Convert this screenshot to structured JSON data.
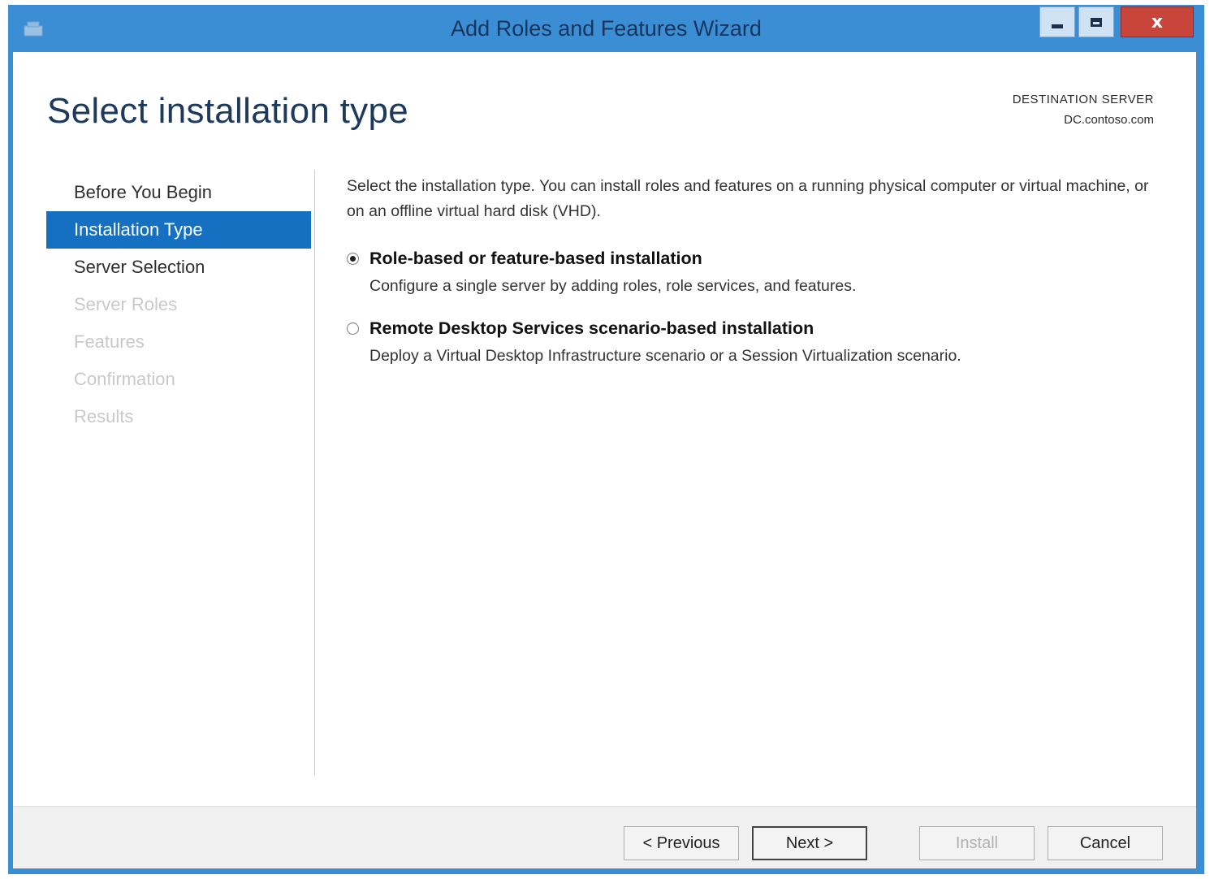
{
  "window": {
    "title": "Add Roles and Features Wizard",
    "controls": [
      "minimize-icon",
      "maximize-icon",
      "close-icon"
    ],
    "close_glyph": "x",
    "title_bar_color": "#3c8ed4",
    "close_color": "#c7453a"
  },
  "header": {
    "page_title": "Select installation type",
    "destination_label": "DESTINATION SERVER",
    "destination_value": "DC.contoso.com"
  },
  "nav": {
    "items": [
      {
        "label": "Before You Begin",
        "state": "enabled"
      },
      {
        "label": "Installation Type",
        "state": "selected"
      },
      {
        "label": "Server Selection",
        "state": "enabled"
      },
      {
        "label": "Server Roles",
        "state": "disabled"
      },
      {
        "label": "Features",
        "state": "disabled"
      },
      {
        "label": "Confirmation",
        "state": "disabled"
      },
      {
        "label": "Results",
        "state": "disabled"
      }
    ],
    "selected_color": "#1570c2"
  },
  "main": {
    "intro": "Select the installation type. You can install roles and features on a running physical computer or virtual machine, or on an offline virtual hard disk (VHD).",
    "options": [
      {
        "title": "Role-based or feature-based installation",
        "description": "Configure a single server by adding roles, role services, and features.",
        "checked": true
      },
      {
        "title": "Remote Desktop Services scenario-based installation",
        "description": "Deploy a Virtual Desktop Infrastructure scenario or a Session Virtualization scenario.",
        "checked": false
      }
    ]
  },
  "footer": {
    "previous": "< Previous",
    "next": "Next >",
    "install": "Install",
    "install_enabled": false,
    "cancel": "Cancel"
  }
}
